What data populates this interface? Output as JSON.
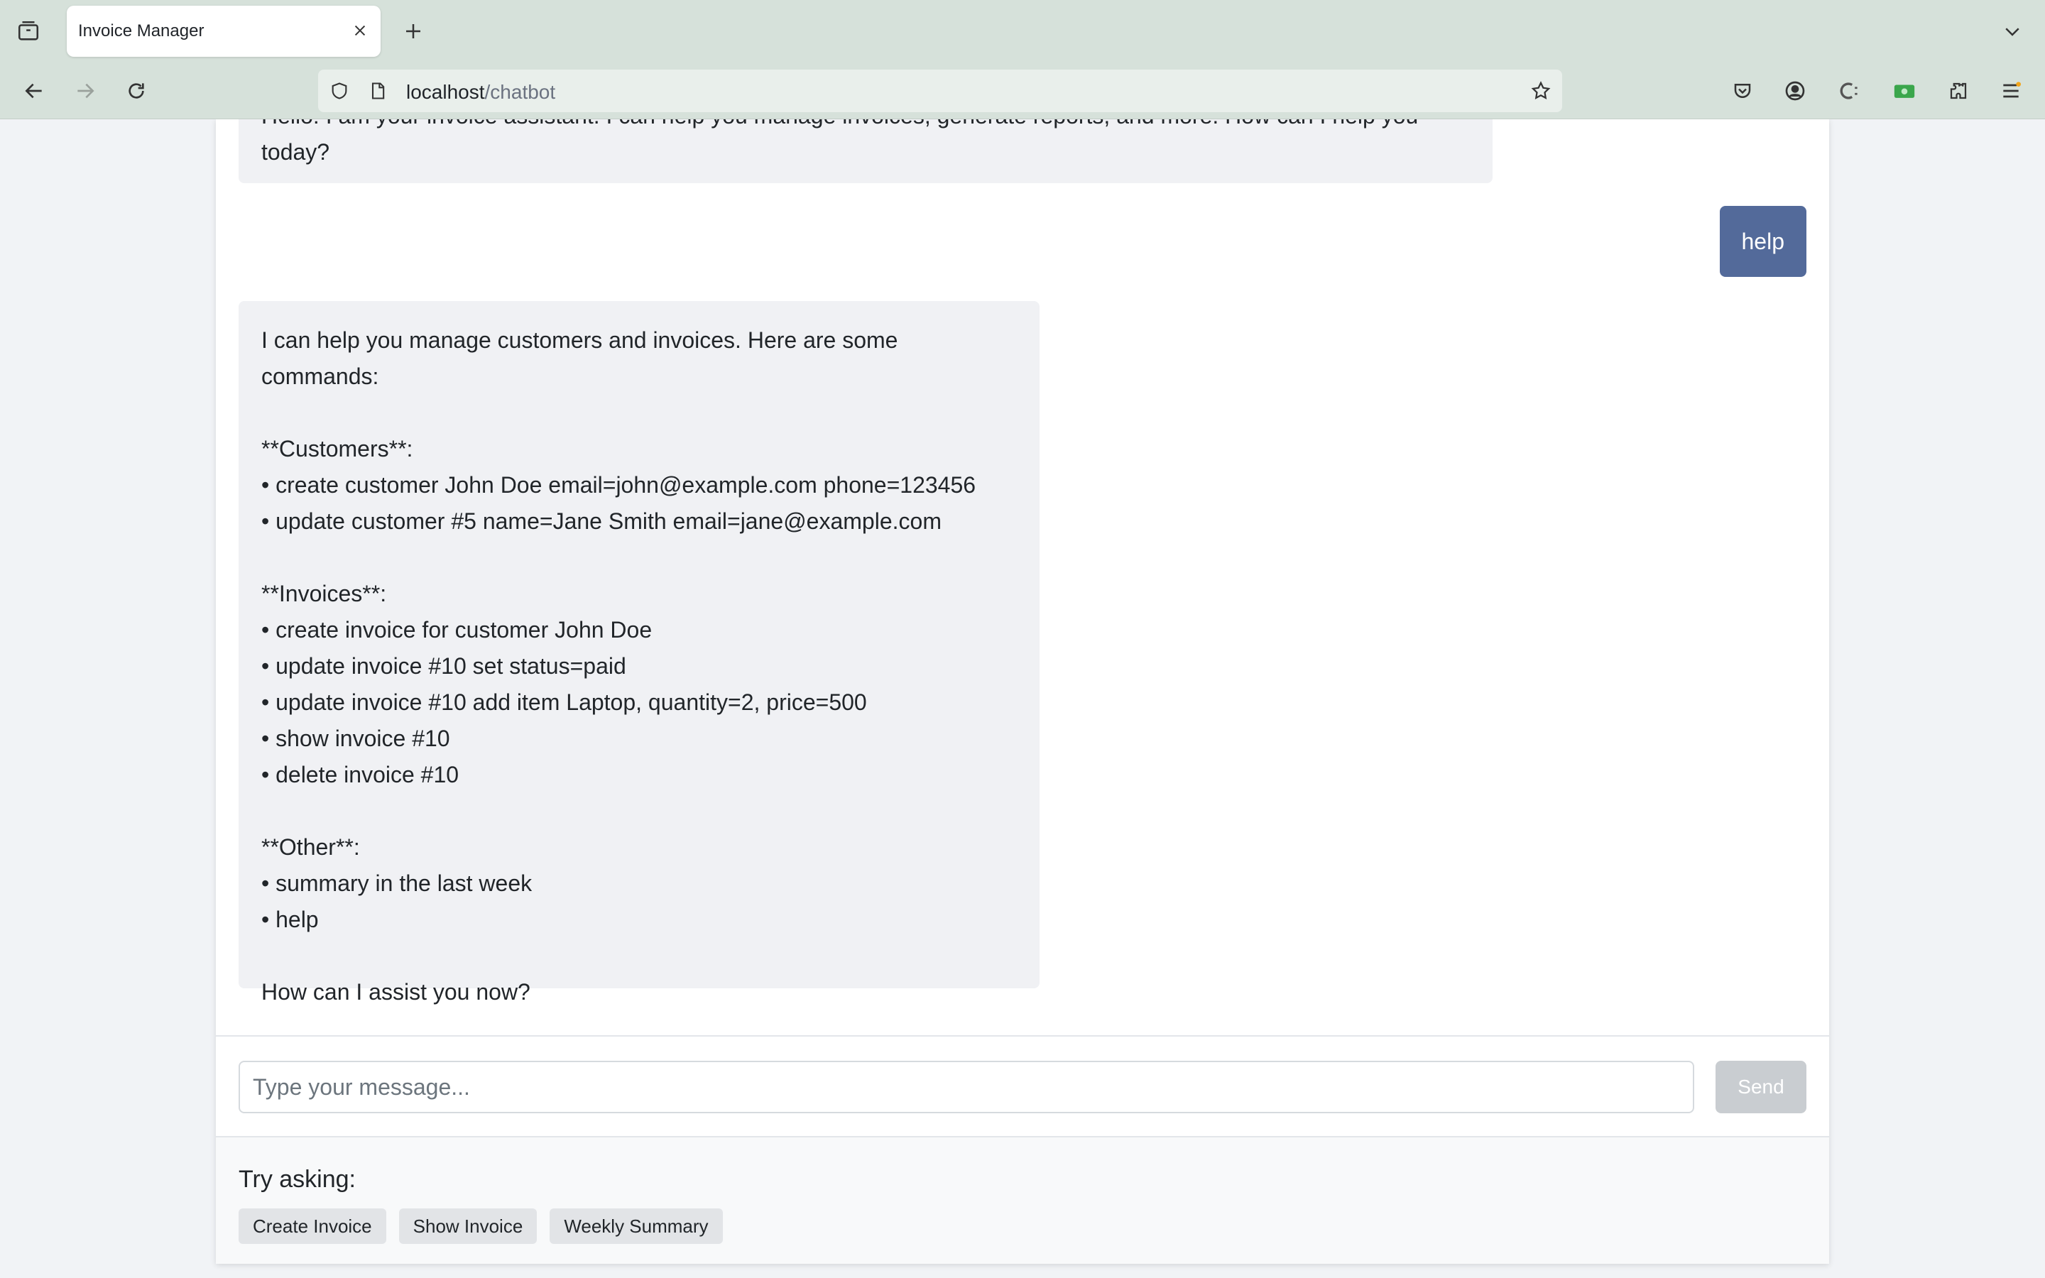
{
  "browser": {
    "tab_title": "Invoice Manager",
    "url_host": "localhost",
    "url_path": "/chatbot"
  },
  "chat": {
    "messages": [
      {
        "role": "bot",
        "text": "Hello! I am your invoice assistant. I can help you manage invoices, generate reports, and more. How can I help you today?"
      },
      {
        "role": "user",
        "text": "help"
      },
      {
        "role": "bot",
        "text": "I can help you manage customers and invoices. Here are some commands:\n\n**Customers**:\n• create customer John Doe email=john@example.com phone=123456\n• update customer #5 name=Jane Smith email=jane@example.com\n\n**Invoices**:\n• create invoice for customer John Doe\n• update invoice #10 set status=paid\n• update invoice #10 add item Laptop, quantity=2, price=500\n• show invoice #10\n• delete invoice #10\n\n**Other**:\n• summary in the last week\n• help\n\nHow can I assist you now?"
      }
    ],
    "input_placeholder": "Type your message...",
    "input_value": "",
    "send_label": "Send"
  },
  "suggestions": {
    "label": "Try asking:",
    "chips": [
      "Create Invoice",
      "Show Invoice",
      "Weekly Summary"
    ]
  },
  "colors": {
    "user_bubble": "#536a9a",
    "bot_bubble": "#f0f1f4",
    "send_disabled": "#c9cdd1",
    "chrome": "#d6e1da"
  }
}
